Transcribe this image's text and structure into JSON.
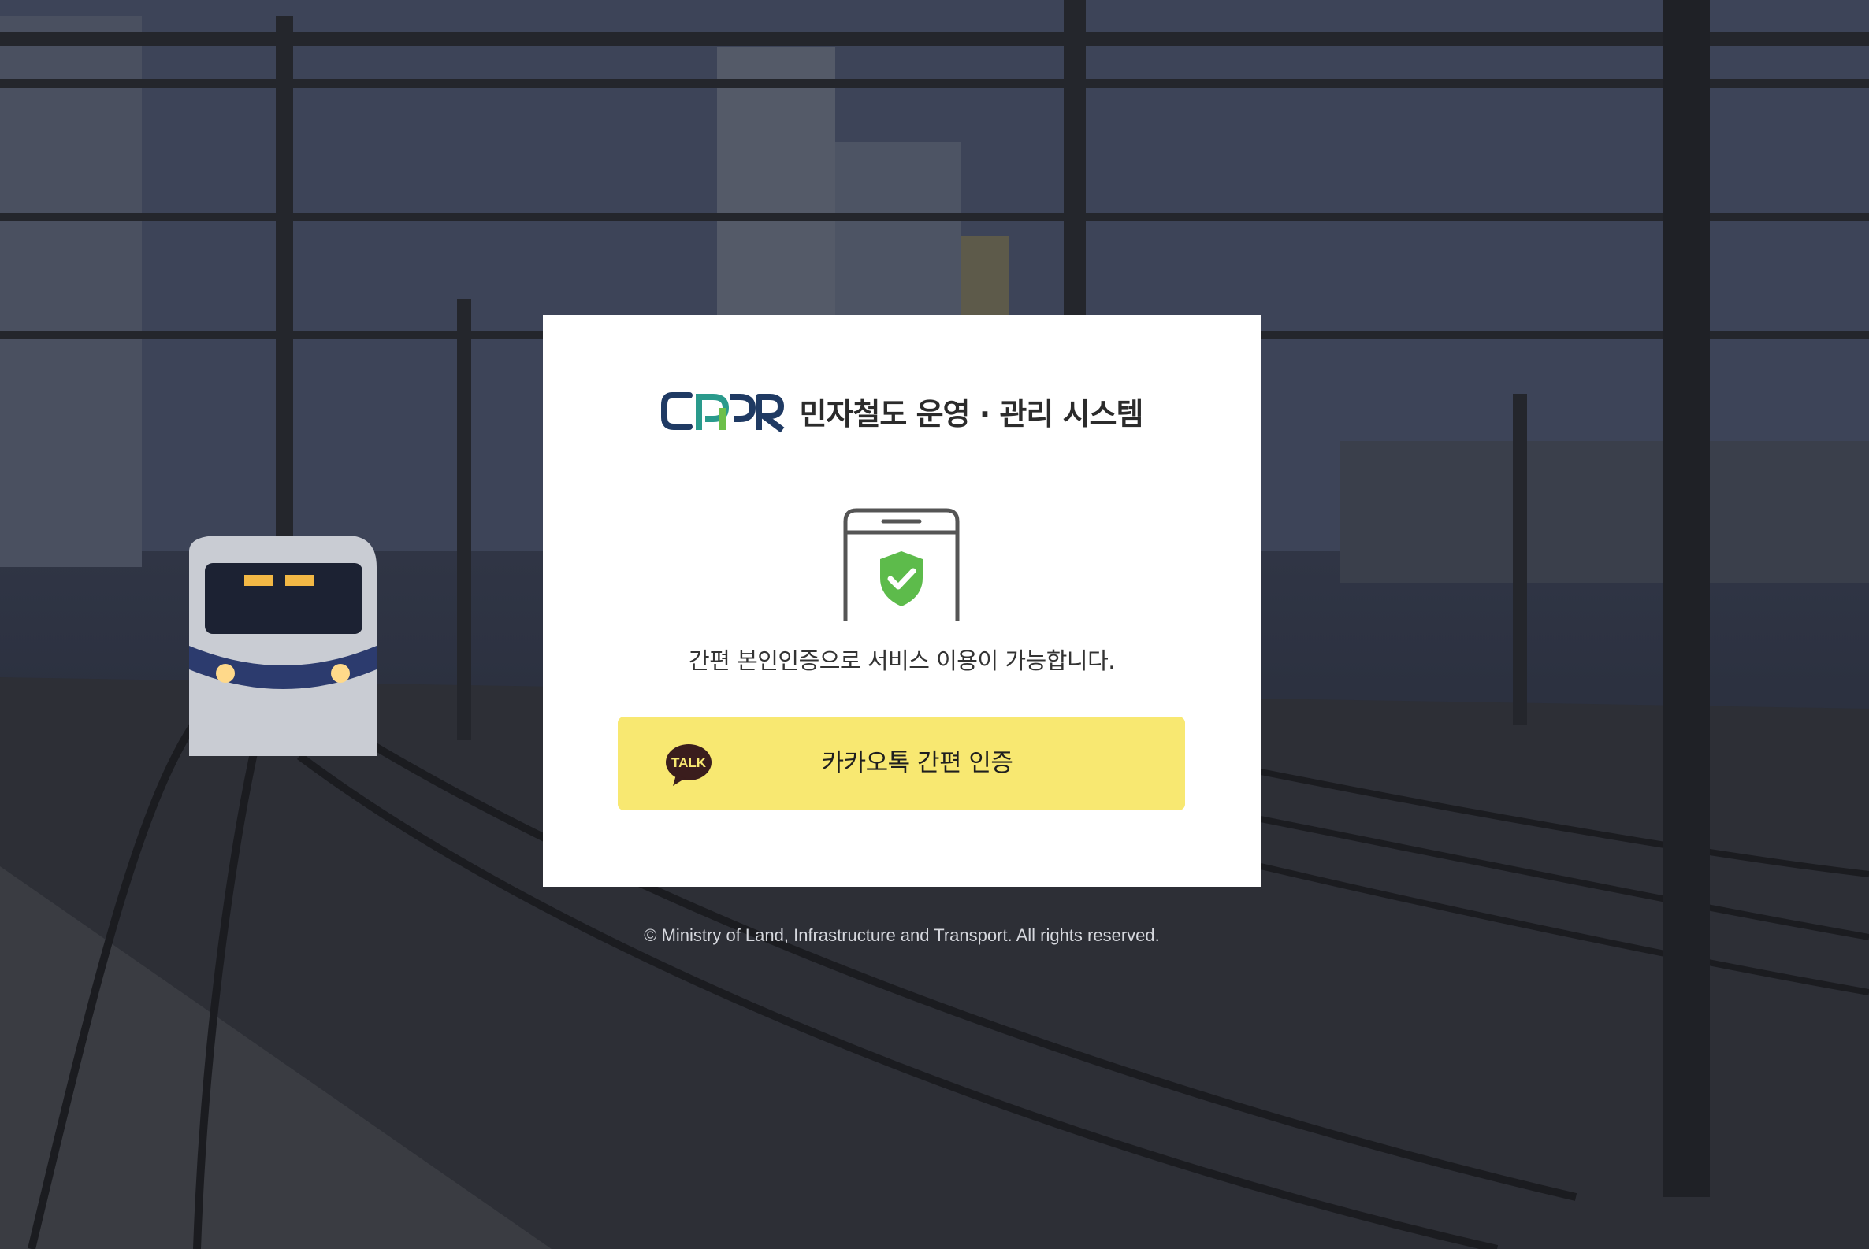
{
  "background": {
    "description_icon": "railway-background-image"
  },
  "brand": {
    "logo_text": "CPPR",
    "title": "민자철도 운영 · 관리 시스템",
    "colors": {
      "navy": "#1f3a63",
      "teal": "#2a9a8c",
      "green": "#6cbf4a"
    }
  },
  "auth": {
    "icon": "phone-shield-check-icon",
    "notice": "간편 본인인증으로 서비스 이용이 가능합니다.",
    "kakao_button_label": "카카오톡 간편 인증",
    "kakao_icon_text": "TALK",
    "kakao_color": "#f8e871"
  },
  "footer": {
    "copyright": "© Ministry of Land, Infrastructure and Transport. All rights reserved."
  }
}
